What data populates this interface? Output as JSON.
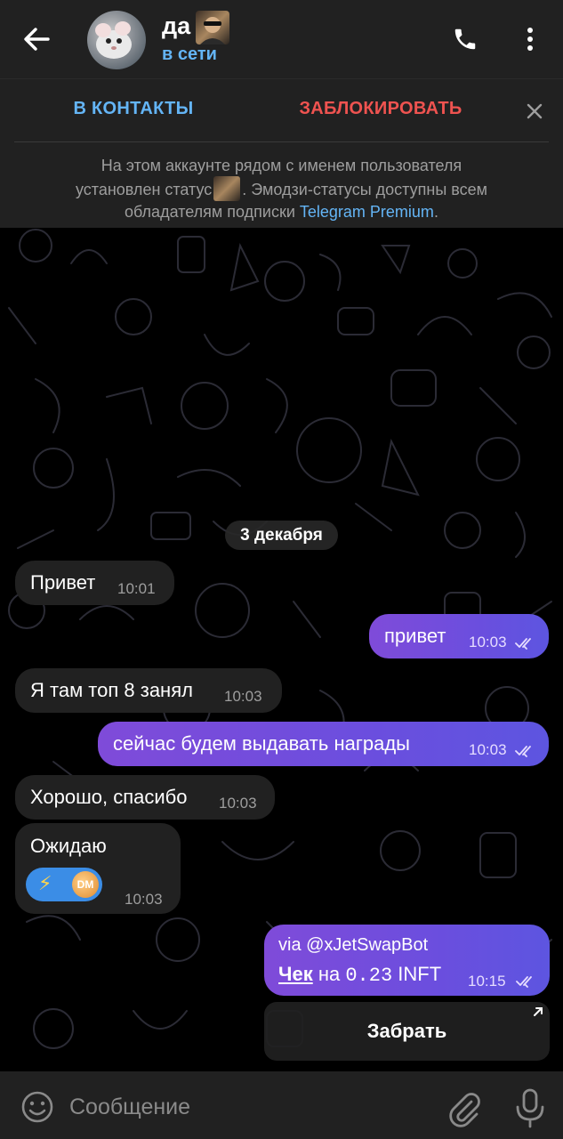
{
  "header": {
    "title": "да",
    "subtitle": "в сети"
  },
  "contact_bar": {
    "add_label": "В КОНТАКТЫ",
    "block_label": "ЗАБЛОКИРОВАТЬ"
  },
  "notice": {
    "line1": "На этом аккаунте рядом с именем пользователя",
    "line2_a": "установлен статус",
    "line2_b": ". Эмодзи-статусы доступны всем",
    "line3_a": "обладателям подписки",
    "line3_link": "Telegram Premium",
    "line3_b": "."
  },
  "chat": {
    "date": "3 декабря",
    "messages": [
      {
        "dir": "in",
        "text": "Привет",
        "time": "10:01"
      },
      {
        "dir": "out",
        "text": "привет",
        "time": "10:03"
      },
      {
        "dir": "in",
        "text": "Я там топ 8 занял",
        "time": "10:03"
      },
      {
        "dir": "out",
        "text": "сейчас будем выдавать награды",
        "time": "10:03"
      },
      {
        "dir": "in",
        "text": "Хорошо, спасибо",
        "time": "10:03"
      },
      {
        "dir": "in",
        "text": "Ожидаю",
        "time": "10:03",
        "reactions": [
          "⚡",
          "DM"
        ]
      },
      {
        "dir": "out",
        "via": "via @xJetSwapBot",
        "check": "Чек",
        "mid": "на",
        "amount": "0.23",
        "token": "INFT",
        "time": "10:15"
      }
    ],
    "inline_button": "Забрать"
  },
  "input": {
    "placeholder": "Сообщение"
  },
  "icons": [
    "back-arrow-icon",
    "phone-icon",
    "more-vertical-icon",
    "close-icon",
    "emoji-icon",
    "paperclip-icon",
    "microphone-icon",
    "double-check-icon",
    "external-link-icon"
  ],
  "colors": {
    "accent": "#64b5f6",
    "danger": "#ef5350",
    "outgoing": "#6b4ede",
    "incoming": "#212121"
  }
}
